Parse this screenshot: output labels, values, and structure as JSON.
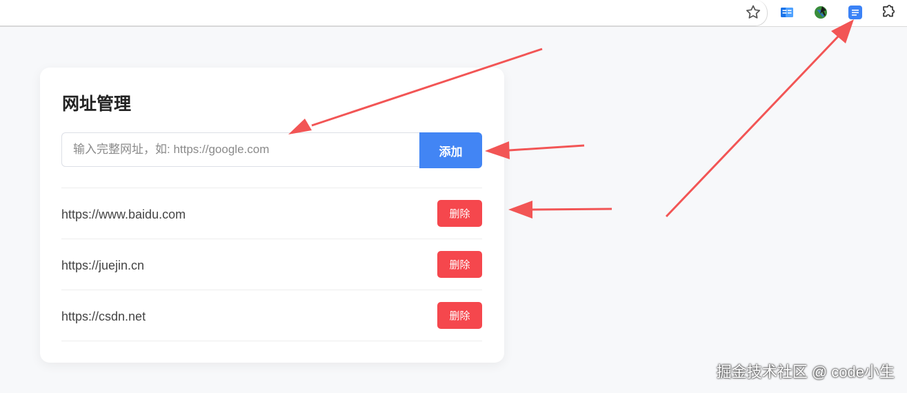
{
  "toolbar": {
    "icons": [
      "star-icon",
      "translate-extension-icon",
      "globe-extension-icon",
      "notes-extension-icon",
      "puzzle-extensions-icon"
    ]
  },
  "card": {
    "title": "网址管理",
    "input_placeholder": "输入完整网址，如: https://google.com",
    "input_value": "",
    "add_label": "添加",
    "delete_label": "删除",
    "urls": [
      "https://www.baidu.com",
      "https://juejin.cn",
      "https://csdn.net"
    ]
  },
  "colors": {
    "primary": "#4285f4",
    "danger": "#f5474d",
    "annotation": "#f25555"
  },
  "watermark": "掘金技术社区 @ code小生"
}
